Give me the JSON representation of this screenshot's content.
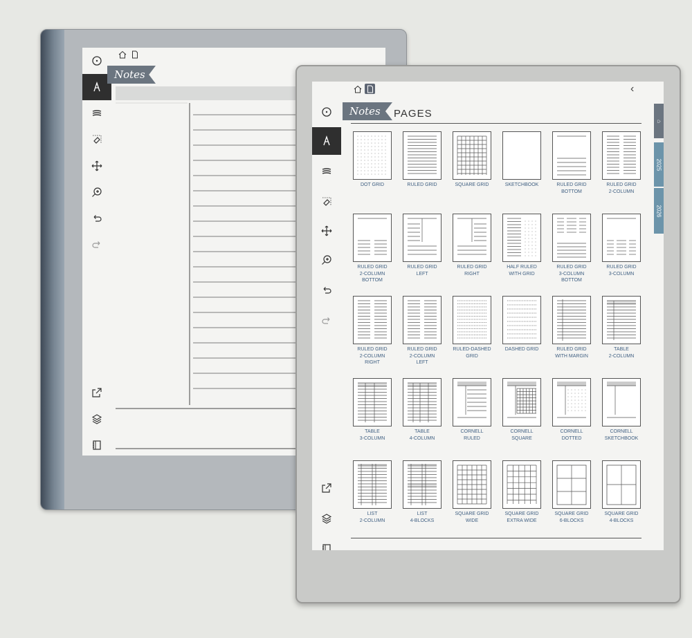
{
  "back": {
    "notes_tag": "Notes",
    "toolbar": [
      "clock-icon",
      "pen-icon",
      "lines-icon",
      "eraser-icon",
      "move-icon",
      "zoom-icon",
      "undo-icon",
      "redo-icon",
      "share-icon",
      "layers-icon",
      "notebook-icon"
    ]
  },
  "front": {
    "notes_tag": "Notes",
    "heading": "PAGES",
    "back_chevron": "‹",
    "side_tabs": [
      {
        "label": "⌂",
        "icon": "home-icon",
        "color": "#6b7580"
      },
      {
        "label": "2025",
        "color": "#6c94aa"
      },
      {
        "label": "2026",
        "color": "#6c94aa"
      }
    ],
    "templates": [
      {
        "id": "dot-grid",
        "lines": [
          "DOT GRID"
        ]
      },
      {
        "id": "ruled-grid",
        "lines": [
          "RULED GRID"
        ]
      },
      {
        "id": "square-grid",
        "lines": [
          "SQUARE GRID"
        ]
      },
      {
        "id": "sketchbook",
        "lines": [
          "SKETCHBOOK"
        ]
      },
      {
        "id": "ruled-grid-bottom",
        "lines": [
          "RULED GRID",
          "BOTTOM"
        ]
      },
      {
        "id": "ruled-grid-2col",
        "lines": [
          "RULED GRID",
          "2-COLUMN"
        ]
      },
      {
        "id": "ruled-grid-2col-bottom",
        "lines": [
          "RULED GRID",
          "2-COLUMN",
          "BOTTOM"
        ]
      },
      {
        "id": "ruled-grid-left",
        "lines": [
          "RULED GRID",
          "LEFT"
        ]
      },
      {
        "id": "ruled-grid-right",
        "lines": [
          "RULED GRID",
          "RIGHT"
        ]
      },
      {
        "id": "half-ruled-grid",
        "lines": [
          "HALF RULED",
          "WITH GRID"
        ]
      },
      {
        "id": "ruled-grid-3col-bottom",
        "lines": [
          "RULED GRID",
          "3-COLUMN",
          "BOTTOM"
        ]
      },
      {
        "id": "ruled-grid-3col",
        "lines": [
          "RULED GRID",
          "3-COLUMN"
        ]
      },
      {
        "id": "ruled-grid-2col-right",
        "lines": [
          "RULED GRID",
          "2-COLUMN",
          "RIGHT"
        ]
      },
      {
        "id": "ruled-grid-2col-left",
        "lines": [
          "RULED GRID",
          "2-COLUMN",
          "LEFT"
        ]
      },
      {
        "id": "ruled-dashed-grid",
        "lines": [
          "RULED-DASHED",
          "GRID"
        ]
      },
      {
        "id": "dashed-grid",
        "lines": [
          "DASHED GRID"
        ]
      },
      {
        "id": "ruled-grid-margin",
        "lines": [
          "RULED GRID",
          "WITH MARGIN"
        ]
      },
      {
        "id": "table-2col",
        "lines": [
          "TABLE",
          "2-COLUMN"
        ]
      },
      {
        "id": "table-3col",
        "lines": [
          "TABLE",
          "3-COLUMN"
        ]
      },
      {
        "id": "table-4col",
        "lines": [
          "TABLE",
          "4-COLUMN"
        ]
      },
      {
        "id": "cornell-ruled",
        "lines": [
          "CORNELL",
          "RULED"
        ]
      },
      {
        "id": "cornell-square",
        "lines": [
          "CORNELL",
          "SQUARE"
        ]
      },
      {
        "id": "cornell-dotted",
        "lines": [
          "CORNELL",
          "DOTTED"
        ]
      },
      {
        "id": "cornell-sketchbook",
        "lines": [
          "CORNELL",
          "SKETCHBOOK"
        ]
      },
      {
        "id": "list-2col",
        "lines": [
          "LIST",
          "2-COLUMN"
        ]
      },
      {
        "id": "list-4blocks",
        "lines": [
          "LIST",
          "4-BLOCKS"
        ]
      },
      {
        "id": "square-grid-wide",
        "lines": [
          "SQUARE GRID",
          "WIDE"
        ]
      },
      {
        "id": "square-grid-extra-wide",
        "lines": [
          "SQUARE GRID",
          "EXTRA WIDE"
        ]
      },
      {
        "id": "square-grid-6blocks",
        "lines": [
          "SQUARE GRID",
          "6-BLOCKS"
        ]
      },
      {
        "id": "square-grid-4blocks",
        "lines": [
          "SQUARE GRID",
          "4-BLOCKS"
        ]
      }
    ]
  }
}
